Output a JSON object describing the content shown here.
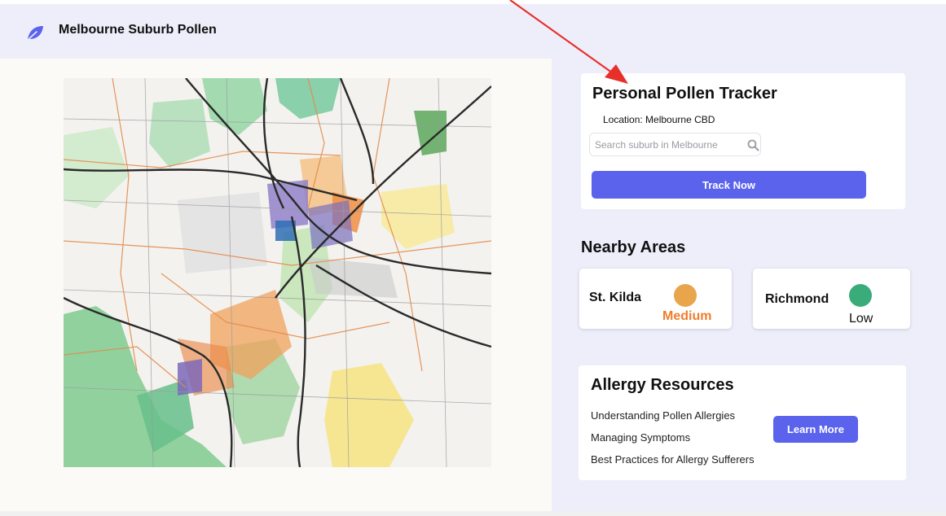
{
  "header": {
    "title": "Melbourne Suburb Pollen",
    "logo_icon": "leaf-icon",
    "background": "#eeeefb"
  },
  "map": {
    "alt": "Melbourne suburb pollen map"
  },
  "tracker": {
    "title": "Personal Pollen Tracker",
    "location_text": "Location: Melbourne CBD",
    "search_placeholder": "Search suburb in Melbourne",
    "search_icon": "search-icon",
    "button_label": "Track Now"
  },
  "nearby": {
    "title": "Nearby Areas",
    "areas": [
      {
        "name": "St. Kilda",
        "level": "Medium",
        "dot_color": "#e8a54b",
        "level_color": "#ef7d2c"
      },
      {
        "name": "Richmond",
        "level": "Low",
        "dot_color": "#3aac7a",
        "level_color": "#111111"
      }
    ]
  },
  "resources": {
    "title": "Allergy Resources",
    "links": [
      "Understanding Pollen Allergies",
      "Managing Symptoms",
      "Best Practices for Allergy Sufferers"
    ],
    "button_label": "Learn More"
  },
  "colors": {
    "accent": "#5b63ec",
    "annotation_arrow": "#e8302a"
  }
}
